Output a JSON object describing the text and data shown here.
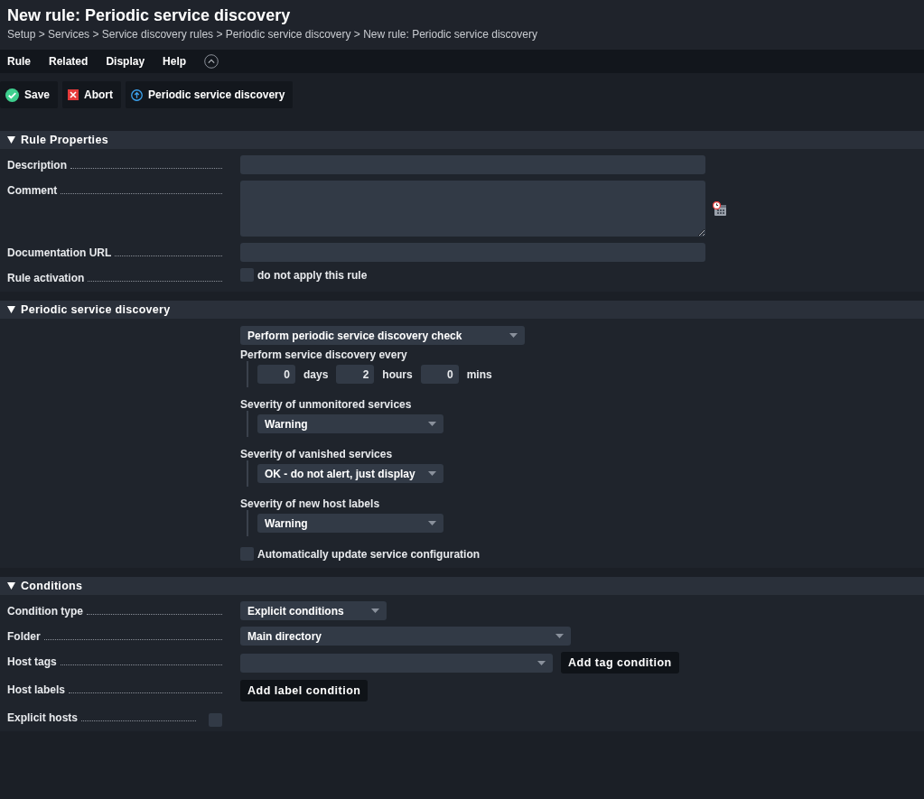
{
  "title": "New rule: Periodic service discovery",
  "breadcrumb": "Setup > Services > Service discovery rules > Periodic service discovery > New rule: Periodic service discovery",
  "menu": [
    {
      "label": "Rule"
    },
    {
      "label": "Related"
    },
    {
      "label": "Display"
    },
    {
      "label": "Help"
    }
  ],
  "actions": [
    {
      "label": "Save",
      "kind": "save"
    },
    {
      "label": "Abort",
      "kind": "abort"
    },
    {
      "label": "Periodic service discovery",
      "kind": "back"
    }
  ],
  "sections": [
    {
      "title": "Rule Properties",
      "expanded": true,
      "kind": "form",
      "rows": [
        {
          "label": "Description",
          "kind": "text"
        },
        {
          "label": "Comment",
          "kind": "textarea"
        },
        {
          "label": "Documentation URL",
          "kind": "text"
        },
        {
          "label": "Rule activation",
          "kind": "checkbox",
          "text": "do not apply this rule",
          "checked": false
        }
      ]
    },
    {
      "title": "Periodic service discovery",
      "expanded": true,
      "kind": "discovery",
      "mode": "Perform periodic service discovery check",
      "interval": {
        "label": "Perform service discovery every",
        "parts": [
          {
            "value": "0",
            "unit": "days"
          },
          {
            "value": "2",
            "unit": "hours"
          },
          {
            "value": "0",
            "unit": "mins"
          }
        ]
      },
      "severities": [
        {
          "label": "Severity of unmonitored services",
          "value": "Warning"
        },
        {
          "label": "Severity of vanished services",
          "value": "OK - do not alert, just display"
        },
        {
          "label": "Severity of new host labels",
          "value": "Warning"
        }
      ],
      "auto_update": {
        "text": "Automatically update service configuration",
        "checked": false
      }
    },
    {
      "title": "Conditions",
      "expanded": true,
      "kind": "form",
      "rows": [
        {
          "label": "Condition type",
          "kind": "select",
          "value": "Explicit conditions"
        },
        {
          "label": "Folder",
          "kind": "wide_select",
          "value": "Main directory"
        },
        {
          "label": "Host tags",
          "kind": "select_button",
          "button": "Add tag condition"
        },
        {
          "label": "Host labels",
          "kind": "button",
          "button": "Add label condition"
        },
        {
          "label": "Explicit hosts",
          "kind": "checkbox",
          "checked": false
        }
      ]
    }
  ]
}
